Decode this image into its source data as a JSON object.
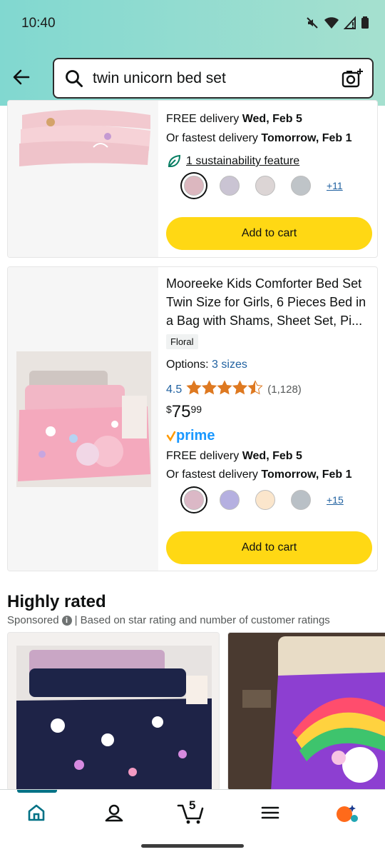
{
  "status_bar": {
    "time": "10:40"
  },
  "search": {
    "query": "twin unicorn bed set"
  },
  "card1": {
    "delivery_free_prefix": "FREE delivery ",
    "delivery_free_date": "Wed, Feb 5",
    "delivery_fast_prefix": "Or fastest delivery ",
    "delivery_fast_date": "Tomorrow, Feb 1",
    "sustainability": "1 sustainability feature",
    "swatch_colors": [
      "#dcb7bf",
      "#cac4d3",
      "#dcd5d5",
      "#bfc4c8"
    ],
    "more_colors": "+11",
    "add_to_cart": "Add to cart"
  },
  "card2": {
    "title": "Mooreeke Kids Comforter Bed Set Twin Size for Girls, 6 Pieces Bed in a Bag with Shams, Sheet Set, Pi...",
    "badge": "Floral",
    "options_label": "Options:",
    "options_link": "3 sizes",
    "rating_value": "4.5",
    "rating_stars": 4.5,
    "rating_count": "(1,128)",
    "price_currency": "$",
    "price_whole": "75",
    "price_cents": "99",
    "prime": "prime",
    "delivery_free_prefix": "FREE delivery ",
    "delivery_free_date": "Wed, Feb 5",
    "delivery_fast_prefix": "Or fastest delivery ",
    "delivery_fast_date": "Tomorrow, Feb 1",
    "swatch_colors": [
      "#dbb8c6",
      "#b5b0e0",
      "#fbe6cc",
      "#b9c0c6"
    ],
    "more_colors": "+15",
    "add_to_cart": "Add to cart"
  },
  "section": {
    "title": "Highly rated",
    "sponsored": "Sponsored",
    "description": "| Based on star rating and number of customer ratings"
  },
  "colors": {
    "header_start": "#81d8d0",
    "add_to_cart": "#ffd814",
    "link": "#2162a1",
    "star": "#de7921",
    "prime": "#1a98ff",
    "nav_active": "#007185"
  },
  "bottom_nav": {
    "icons": [
      "home-icon",
      "account-icon",
      "cart-icon",
      "menu-icon",
      "assistant-icon"
    ],
    "cart_count": "5"
  }
}
